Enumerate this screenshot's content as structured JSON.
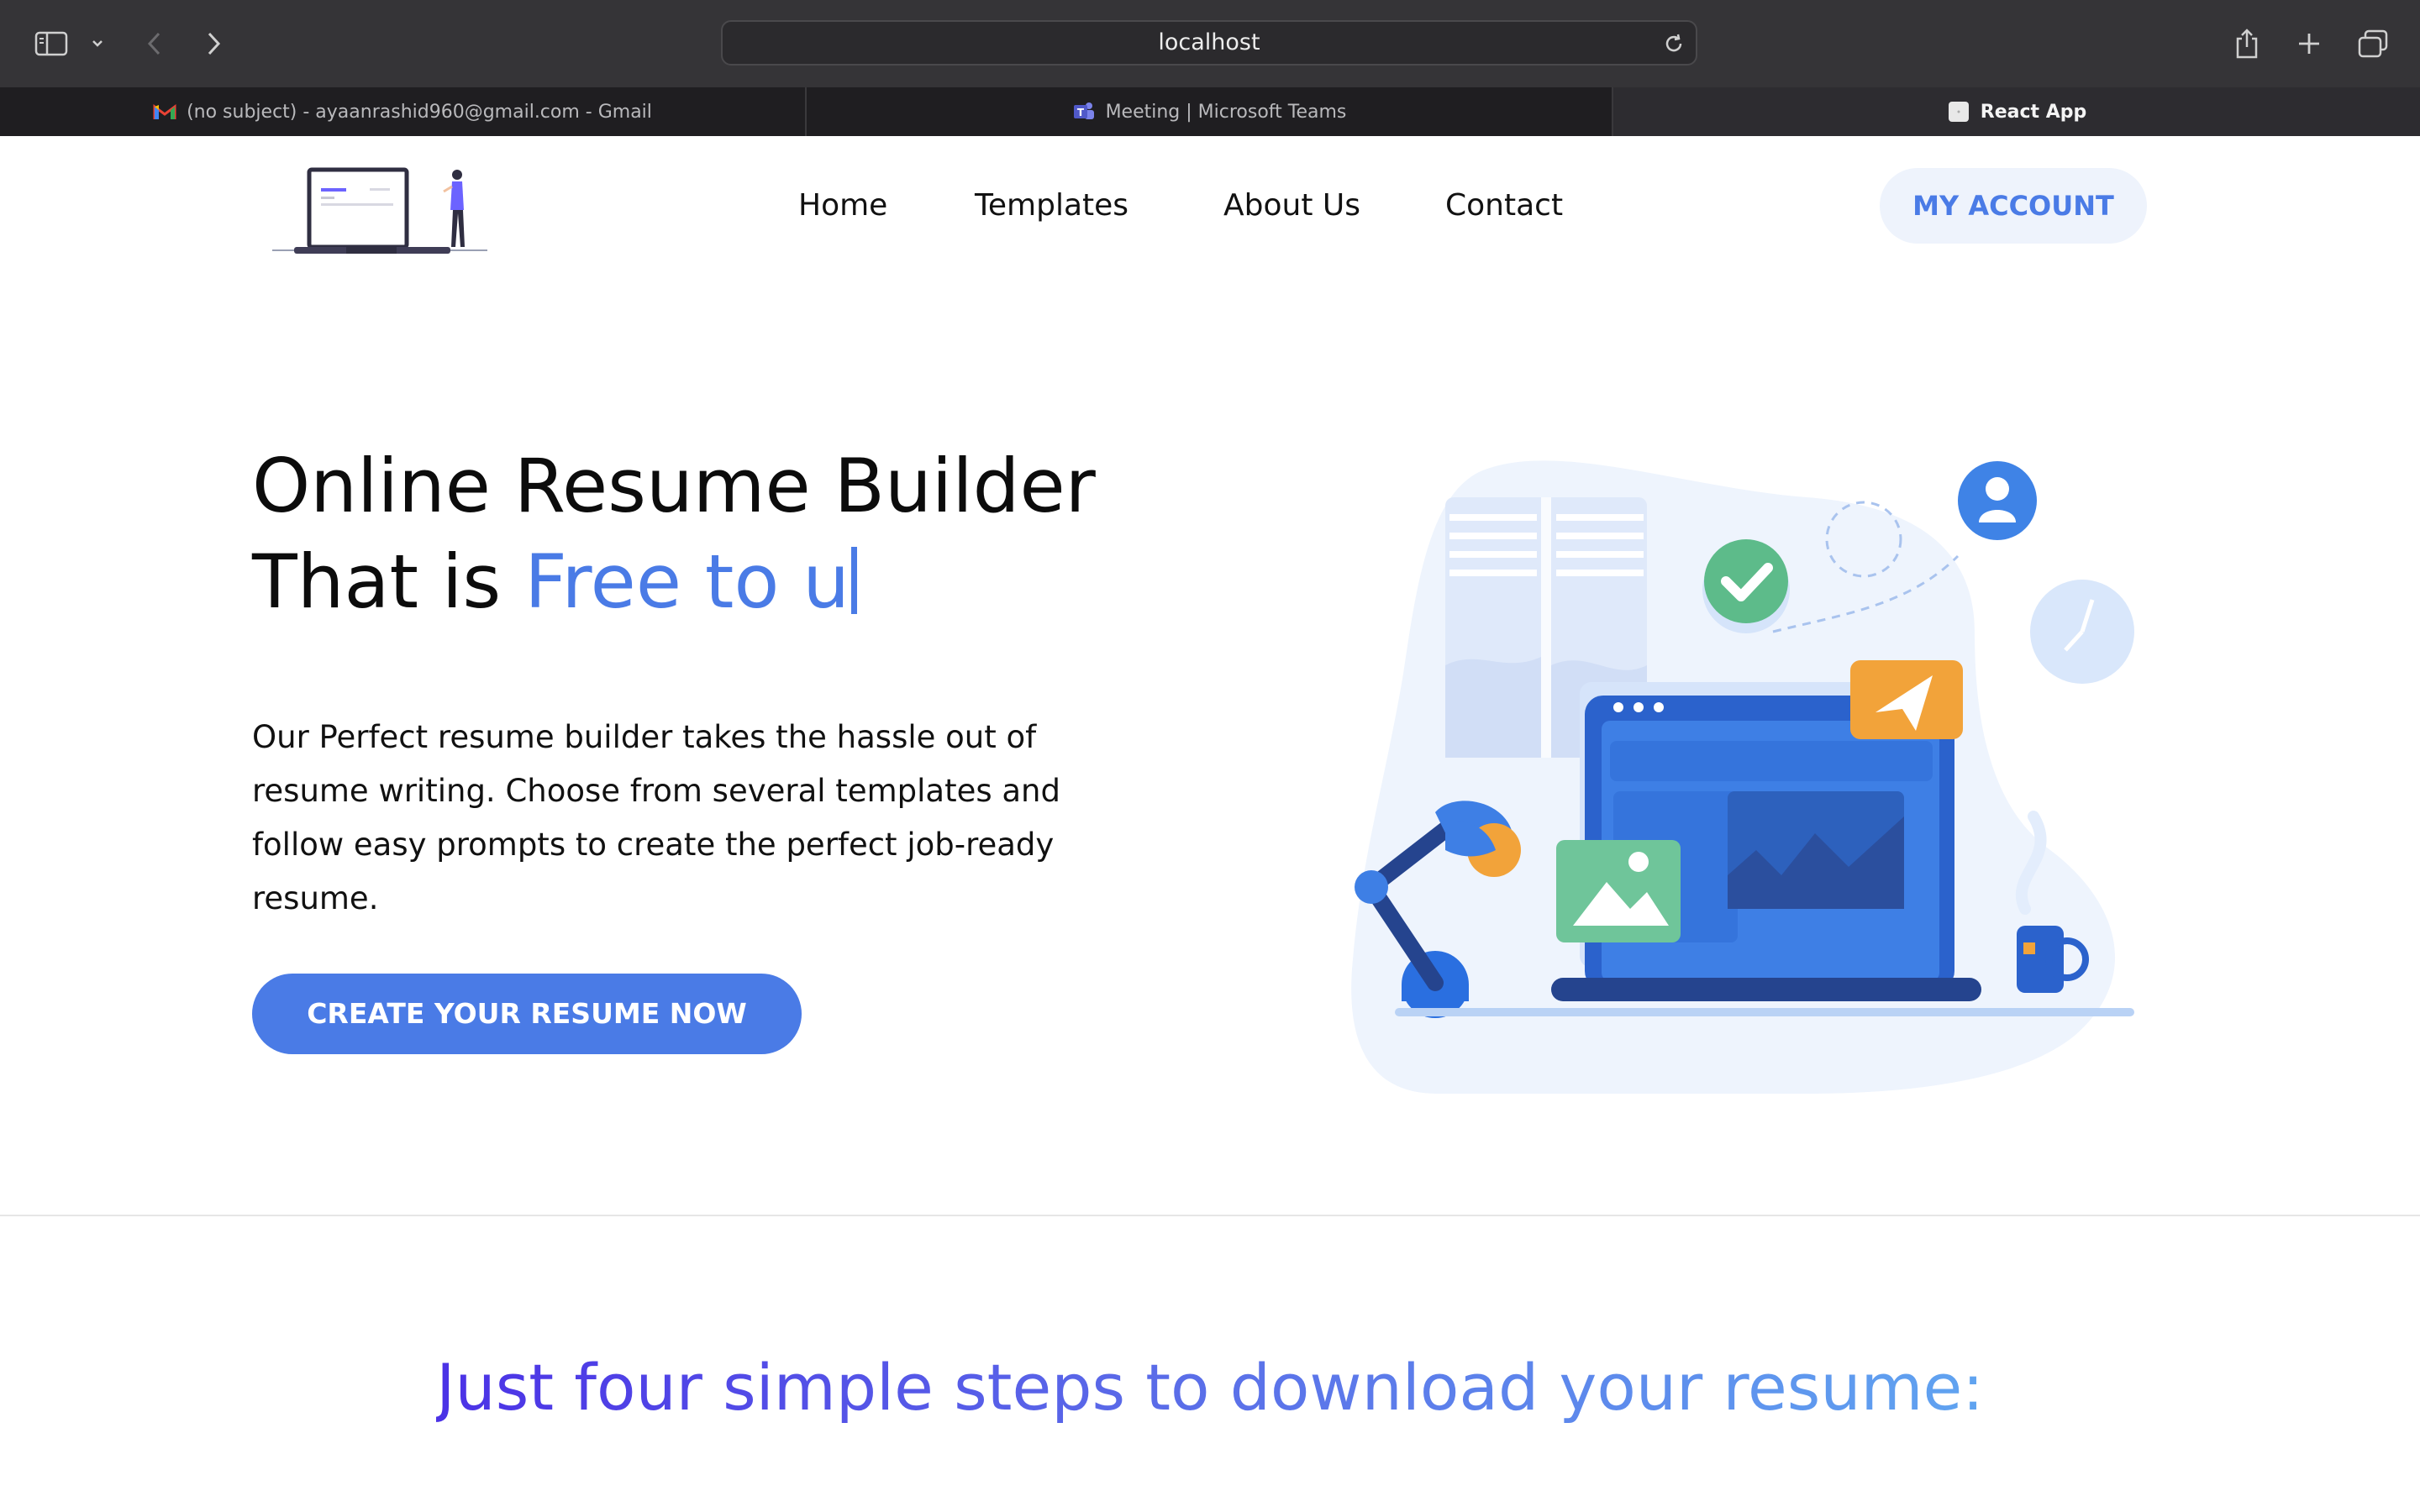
{
  "browser": {
    "address": "localhost",
    "tabs": [
      {
        "title": "(no subject) - ayaanrashid960@gmail.com - Gmail",
        "icon": "gmail-icon"
      },
      {
        "title": "Meeting | Microsoft Teams",
        "icon": "teams-icon"
      },
      {
        "title": "React App",
        "icon": "react-app-favicon",
        "active": true
      }
    ],
    "icons": [
      "sidebar-icon",
      "chevron-down-icon",
      "back-arrow-icon",
      "forward-arrow-icon",
      "reload-icon",
      "share-icon",
      "new-tab-icon",
      "tab-overview-icon"
    ]
  },
  "header": {
    "logo": "laptop-person-logo",
    "nav": [
      "Home",
      "Templates",
      "About Us",
      "Contact"
    ],
    "account_label": "MY ACCOUNT"
  },
  "hero": {
    "title_line1": "Online Resume Builder",
    "title_line2_prefix": "That is",
    "title_line2_accent": "Free to u",
    "description": "Our Perfect resume builder takes the hassle out of resume writing. Choose from several templates and follow easy prompts to create the perfect job-ready resume.",
    "cta_label": "CREATE YOUR RESUME NOW",
    "illustration": "desk-laptop-lamp-illustration"
  },
  "steps": {
    "title": "Just four simple steps to download your resume:"
  },
  "colors": {
    "accent": "#4a7be6",
    "chrome_bg": "#353437",
    "tabbar_bg": "#1f1e21",
    "gradient_start": "#4b32e6",
    "gradient_end": "#60a4f0"
  }
}
